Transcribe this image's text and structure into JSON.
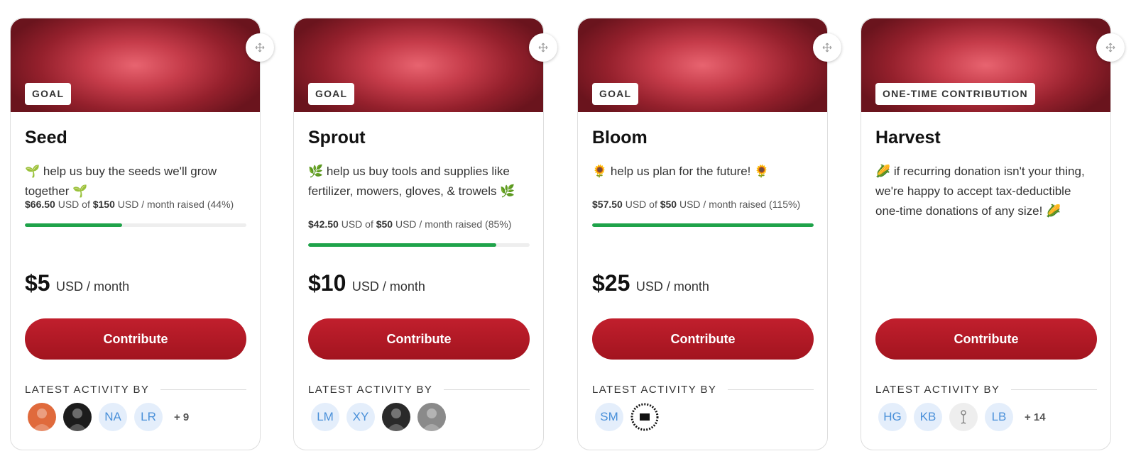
{
  "tiers": [
    {
      "badge": "GOAL",
      "title": "Seed",
      "description": "🌱 help us buy the seeds we'll grow together 🌱",
      "progress": {
        "raised": "$66.50",
        "raised_currency": "USD of",
        "goal": "$150",
        "goal_suffix": "USD / month raised",
        "percent_label": "(44%)",
        "percent": 44
      },
      "price": {
        "amount": "$5",
        "period": "USD / month"
      },
      "button_label": "Contribute",
      "activity_label": "LATEST ACTIVITY BY",
      "avatars": [
        {
          "type": "photo",
          "color": "#e06a3c",
          "name": "avatar-photo-1"
        },
        {
          "type": "photo",
          "color": "#1c1c1c",
          "name": "avatar-photo-2"
        },
        {
          "type": "initials",
          "text": "NA"
        },
        {
          "type": "initials",
          "text": "LR"
        }
      ],
      "more": "+ 9"
    },
    {
      "badge": "GOAL",
      "title": "Sprout",
      "description": "🌿 help us buy tools and supplies like fertilizer, mowers, gloves, & trowels 🌿",
      "progress": {
        "raised": "$42.50",
        "raised_currency": "USD of",
        "goal": "$50",
        "goal_suffix": "USD / month raised",
        "percent_label": "(85%)",
        "percent": 85
      },
      "price": {
        "amount": "$10",
        "period": "USD / month"
      },
      "button_label": "Contribute",
      "activity_label": "LATEST ACTIVITY BY",
      "avatars": [
        {
          "type": "initials",
          "text": "LM"
        },
        {
          "type": "initials",
          "text": "XY"
        },
        {
          "type": "photo",
          "color": "#2a2a2a",
          "name": "avatar-photo-3"
        },
        {
          "type": "photo",
          "color": "#8a8a8a",
          "name": "avatar-photo-4"
        }
      ],
      "more": ""
    },
    {
      "badge": "GOAL",
      "title": "Bloom",
      "description": "🌻 help us plan for the future! 🌻",
      "progress": {
        "raised": "$57.50",
        "raised_currency": "USD of",
        "goal": "$50",
        "goal_suffix": "USD / month raised",
        "percent_label": "(115%)",
        "percent": 100
      },
      "price": {
        "amount": "$25",
        "period": "USD / month"
      },
      "button_label": "Contribute",
      "activity_label": "LATEST ACTIVITY BY",
      "avatars": [
        {
          "type": "initials",
          "text": "SM"
        },
        {
          "type": "photo",
          "color": "#ffffff",
          "name": "avatar-logo-badge"
        }
      ],
      "more": ""
    },
    {
      "badge": "ONE-TIME CONTRIBUTION",
      "title": "Harvest",
      "description": "🌽 if recurring donation isn't your thing, we're happy to accept tax-deductible one-time donations of any size! 🌽",
      "progress": null,
      "price": null,
      "button_label": "Contribute",
      "activity_label": "LATEST ACTIVITY BY",
      "avatars": [
        {
          "type": "initials",
          "text": "HG"
        },
        {
          "type": "initials",
          "text": "KB"
        },
        {
          "type": "photo",
          "color": "#eeeeee",
          "name": "avatar-default-icon"
        },
        {
          "type": "initials",
          "text": "LB"
        }
      ],
      "more": "+ 14"
    }
  ]
}
